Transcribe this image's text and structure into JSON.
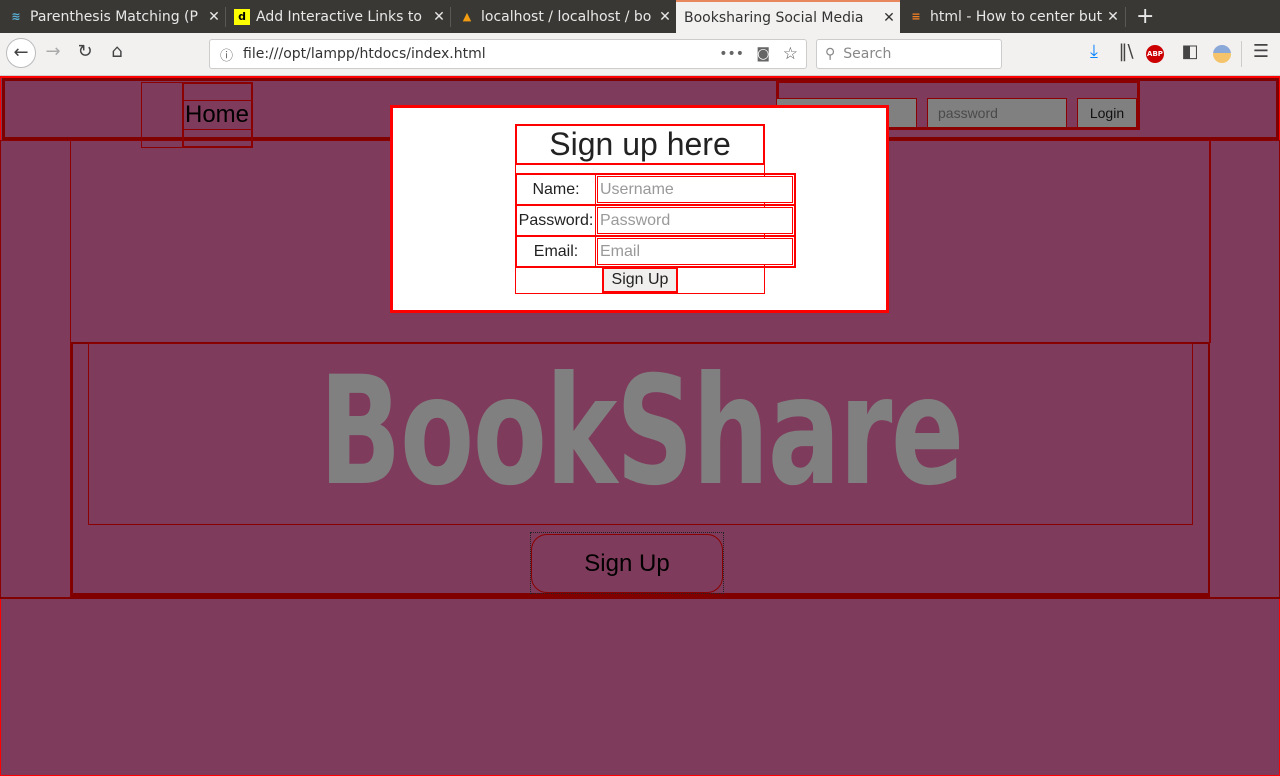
{
  "browser": {
    "tabs": [
      {
        "label": "Parenthesis Matching (P",
        "icon": "stack-icon"
      },
      {
        "label": "Add Interactive Links to",
        "icon": "d-icon"
      },
      {
        "label": "localhost / localhost / bo",
        "icon": "phpmyadmin-icon"
      },
      {
        "label": "Booksharing Social Media",
        "icon": "none",
        "active": true
      },
      {
        "label": "html - How to center but",
        "icon": "stackoverflow-icon"
      }
    ],
    "url": "file:///opt/lampp/htdocs/index.html",
    "search_placeholder": "Search"
  },
  "header": {
    "home_label": "Home",
    "username_placeholder": "",
    "password_placeholder": "password",
    "login_label": "Login"
  },
  "signup_form": {
    "title": "Sign up here",
    "name_label": "Name:",
    "name_placeholder": "Username",
    "password_label": "Password:",
    "password_placeholder": "Password",
    "email_label": "Email:",
    "email_placeholder": "Email",
    "submit_label": "Sign Up"
  },
  "hero": {
    "logo_text": "BookShare",
    "signup_button_label": "Sign Up"
  },
  "colors": {
    "page_background": "#7f3b5c",
    "border_dark_red": "#800000",
    "modal_border": "#ff0000",
    "logo_gray": "#808080"
  }
}
